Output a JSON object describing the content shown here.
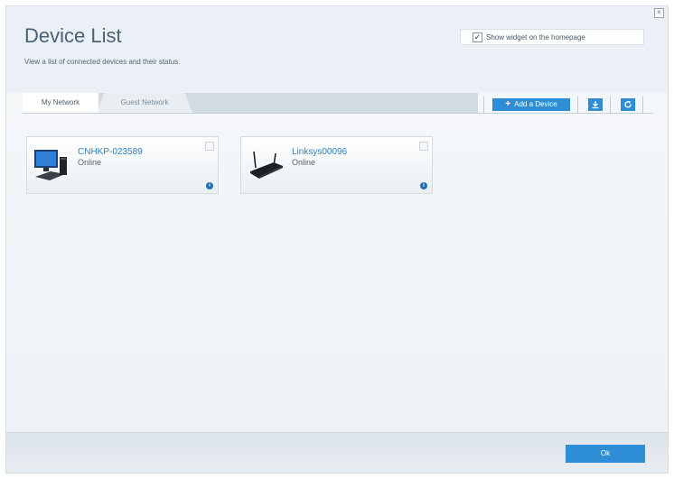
{
  "window": {
    "close_icon": "close-icon"
  },
  "header": {
    "title": "Device List",
    "subtitle": "View a list of connected devices and their status.",
    "widget_toggle": {
      "label": "Show widget on the homepage",
      "checked": true
    }
  },
  "tabs": [
    {
      "label": "My Network",
      "active": true
    },
    {
      "label": "Guest Network",
      "active": false
    }
  ],
  "toolbar": {
    "add_device_label": "Add a Device",
    "download_icon": "download-icon",
    "refresh_icon": "refresh-icon"
  },
  "devices": [
    {
      "name": "CNHKP-023589",
      "status": "Online",
      "icon": "desktop-computer-icon"
    },
    {
      "name": "Linksys00096",
      "status": "Online",
      "icon": "router-icon"
    }
  ],
  "footer": {
    "ok_label": "Ok"
  },
  "colors": {
    "accent": "#2d8ed6",
    "link": "#2e7fbf",
    "title": "#4a6173"
  }
}
